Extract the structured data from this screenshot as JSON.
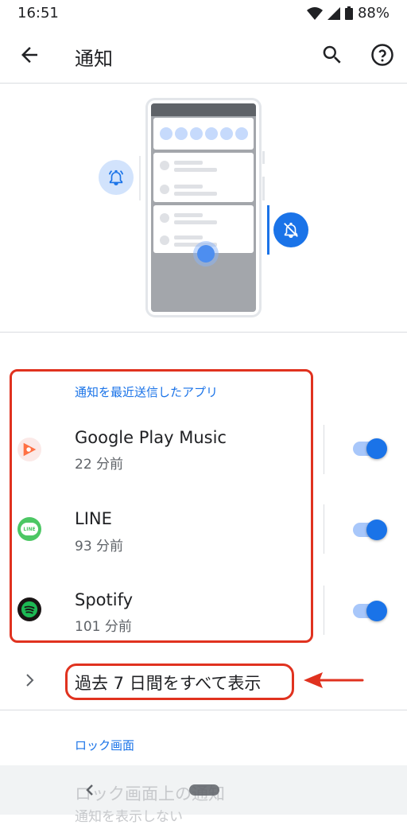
{
  "status_bar": {
    "time": "16:51",
    "battery": "88%"
  },
  "app_bar": {
    "title": "通知"
  },
  "recent_section": {
    "label": "通知を最近送信したアプリ"
  },
  "apps": [
    {
      "name": "Google Play Music",
      "time": "22 分前",
      "enabled": true,
      "icon": "google-play-music-icon"
    },
    {
      "name": "LINE",
      "time": "93 分前",
      "enabled": true,
      "icon": "line-icon"
    },
    {
      "name": "Spotify",
      "time": "101 分前",
      "enabled": true,
      "icon": "spotify-icon"
    }
  ],
  "see_all": {
    "label": "過去 7 日間をすべて表示"
  },
  "lock_section": {
    "label": "ロック画面"
  },
  "lock_item": {
    "title": "ロック画面上の通知",
    "subtitle": "通知を表示しない"
  },
  "colors": {
    "accent": "#1a73e8",
    "annotation": "#e0321f"
  }
}
